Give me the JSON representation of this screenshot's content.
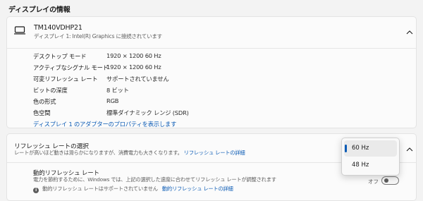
{
  "page": {
    "heading": "ディスプレイの情報"
  },
  "display_card": {
    "device_name": "TM140VDHP21",
    "device_subtitle": "ディスプレイ 1: Intel(R) Graphics に接続されています",
    "icon": "monitor-icon",
    "expanded": true,
    "rows": [
      {
        "label": "デスクトップ モード",
        "value": "1920 × 1200 60 Hz"
      },
      {
        "label": "アクティブなシグナル モード",
        "value": "1920 × 1200 60 Hz"
      },
      {
        "label": "可変リフレッシュ レート",
        "value": "サポートされていません"
      },
      {
        "label": "ビットの深度",
        "value": "8 ビット"
      },
      {
        "label": "色の形式",
        "value": "RGB"
      },
      {
        "label": "色空間",
        "value": "標準ダイナミック レンジ (SDR)"
      }
    ],
    "adapter_link": "ディスプレイ 1 のアダプターのプロパティを表示します"
  },
  "refresh_card": {
    "title": "リフレッシュ レートの選択",
    "description": "レートが高いほど動きは滑らかになりますが、消費電力も大きくなります。",
    "details_link": "リフレッシュ レートの詳細",
    "dropdown": {
      "options": [
        "60 Hz",
        "48 Hz"
      ],
      "selected": "60 Hz"
    },
    "dynamic": {
      "title": "動的リフレッシュ レート",
      "description": "電力を節約するために、Windows では、上記の選択した速度に合わせてリフレッシュ レートが調整されます",
      "note": "動的リフレッシュ レートはサポートされていません",
      "note_link": "動的リフレッシュ レートの詳細",
      "toggle_label": "オフ",
      "toggle_on": false
    }
  },
  "colors": {
    "accent": "#0b5bb5",
    "background": "#f3f3f3",
    "card": "#fbfbfb"
  }
}
